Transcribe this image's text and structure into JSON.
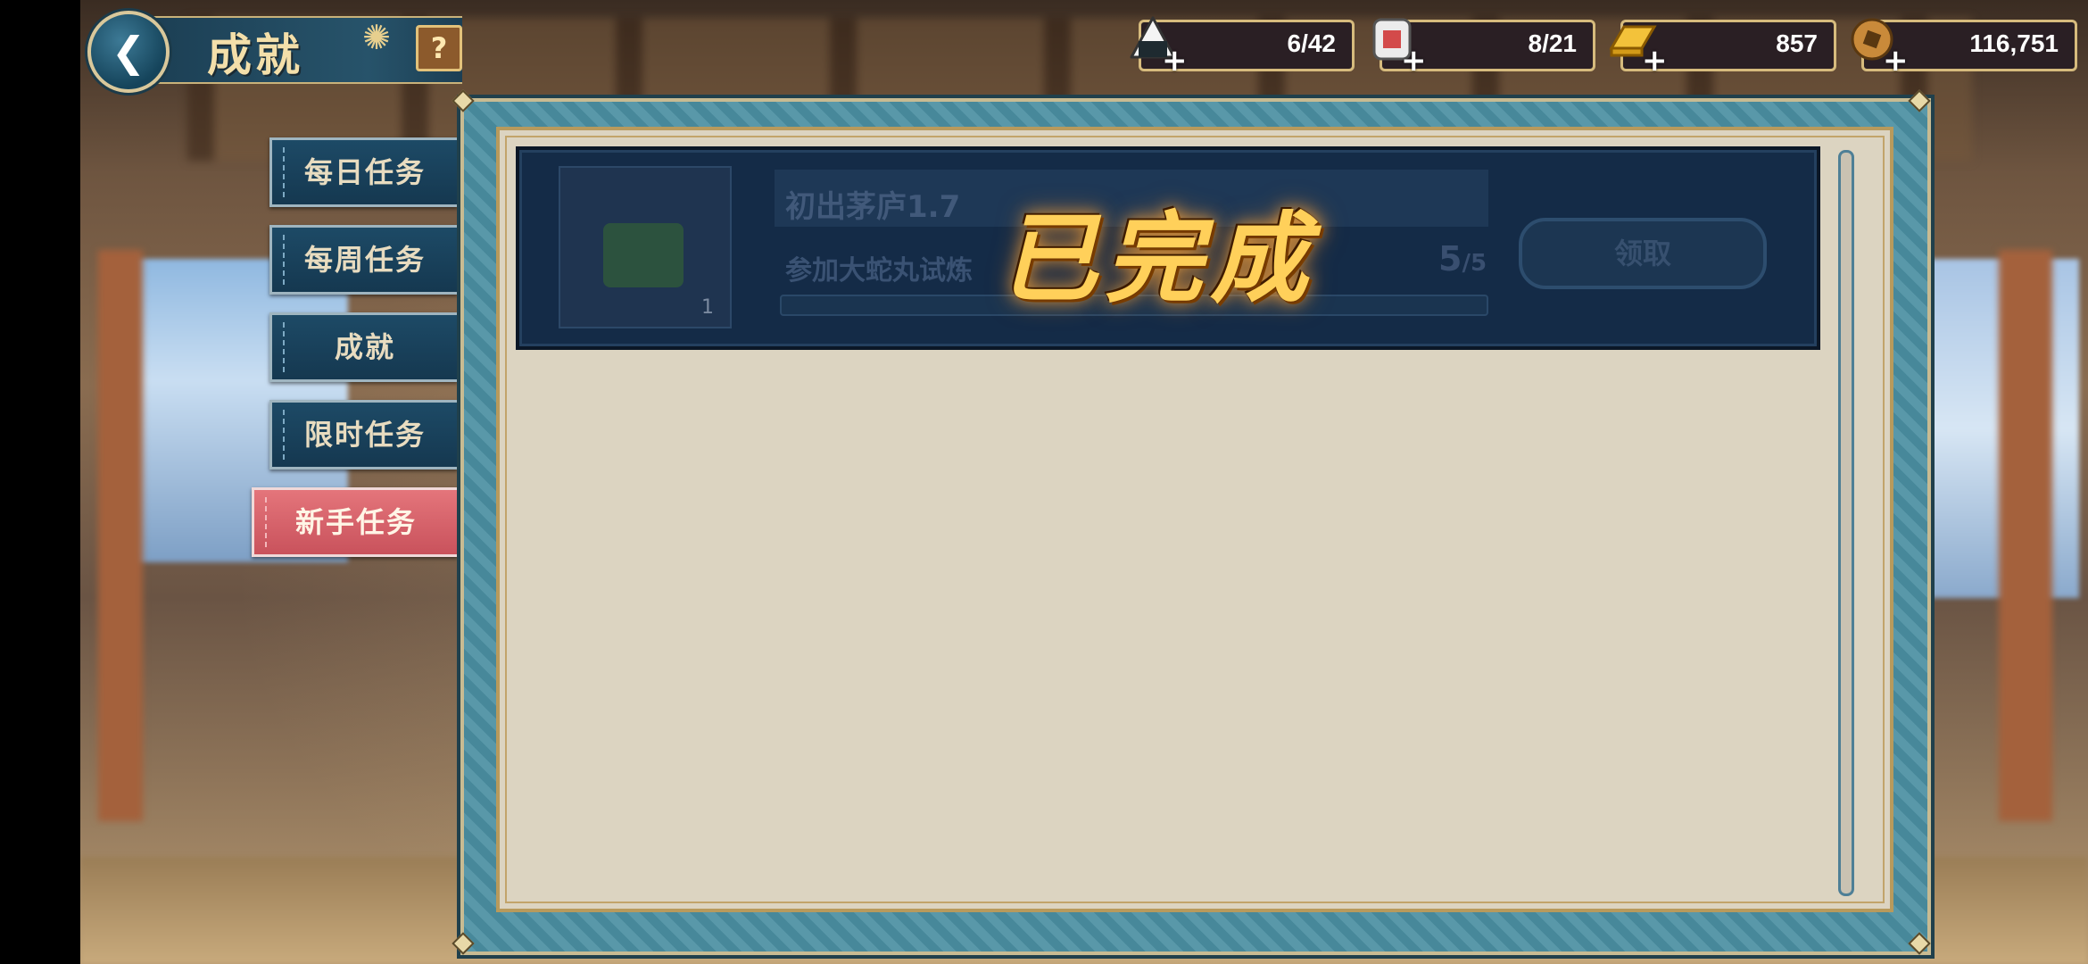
{
  "header": {
    "title": "成就",
    "help_label": "?"
  },
  "resources": [
    {
      "name": "stamina",
      "icon": "onigiri-icon",
      "value": "6/42"
    },
    {
      "name": "ticket",
      "icon": "charm-icon",
      "value": "8/21"
    },
    {
      "name": "gold",
      "icon": "gold-ingot-icon",
      "value": "857"
    },
    {
      "name": "coin",
      "icon": "coin-icon",
      "value": "116,751"
    }
  ],
  "tabs": [
    {
      "label": "每日任务",
      "active": false
    },
    {
      "label": "每周任务",
      "active": false
    },
    {
      "label": "成就",
      "active": false
    },
    {
      "label": "限时任务",
      "active": false
    },
    {
      "label": "新手任务",
      "active": true
    }
  ],
  "achievement": {
    "name": "初出茅庐1.7",
    "desc": "参加大蛇丸试炼",
    "reward_count": "1",
    "progress_current": "5",
    "progress_total": "/5",
    "button_label": "领取",
    "status_stamp": "已完成"
  },
  "colors": {
    "active_tab": "#d9636b",
    "panel_frame": "#4b8fa2",
    "panel_bg": "#dcd4c1",
    "stamp": "#ffd05a"
  }
}
